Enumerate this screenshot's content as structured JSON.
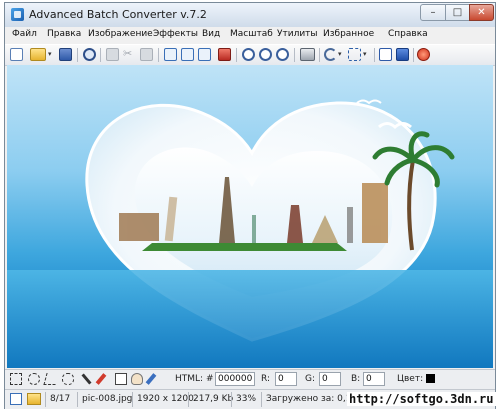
{
  "window": {
    "title": "Advanced Batch Converter v.7.2"
  },
  "titlebar_buttons": {
    "minimize": "–",
    "maximize": "□",
    "close": "✕"
  },
  "menu": [
    "Файл",
    "Правка",
    "Изображение",
    "Эффекты",
    "Вид",
    "Масштаб",
    "Утилиты",
    "Избранное",
    "Справка"
  ],
  "tools": {
    "html_label": "HTML: #",
    "html_value": "000000",
    "r_label": "R:",
    "r_value": "0",
    "g_label": "G:",
    "g_value": "0",
    "b_label": "B:",
    "b_value": "0",
    "color_label": "Цвет:",
    "color_value": "#000000"
  },
  "status": {
    "counter": "8/17",
    "filename": "pic-008.jpg",
    "dimensions": "1920 x 1200",
    "filesize": "217,9 Kb",
    "zoom": "33%",
    "loaded": "Загружено за: 0,178"
  },
  "watermark": "http://softgo.3dn.ru"
}
